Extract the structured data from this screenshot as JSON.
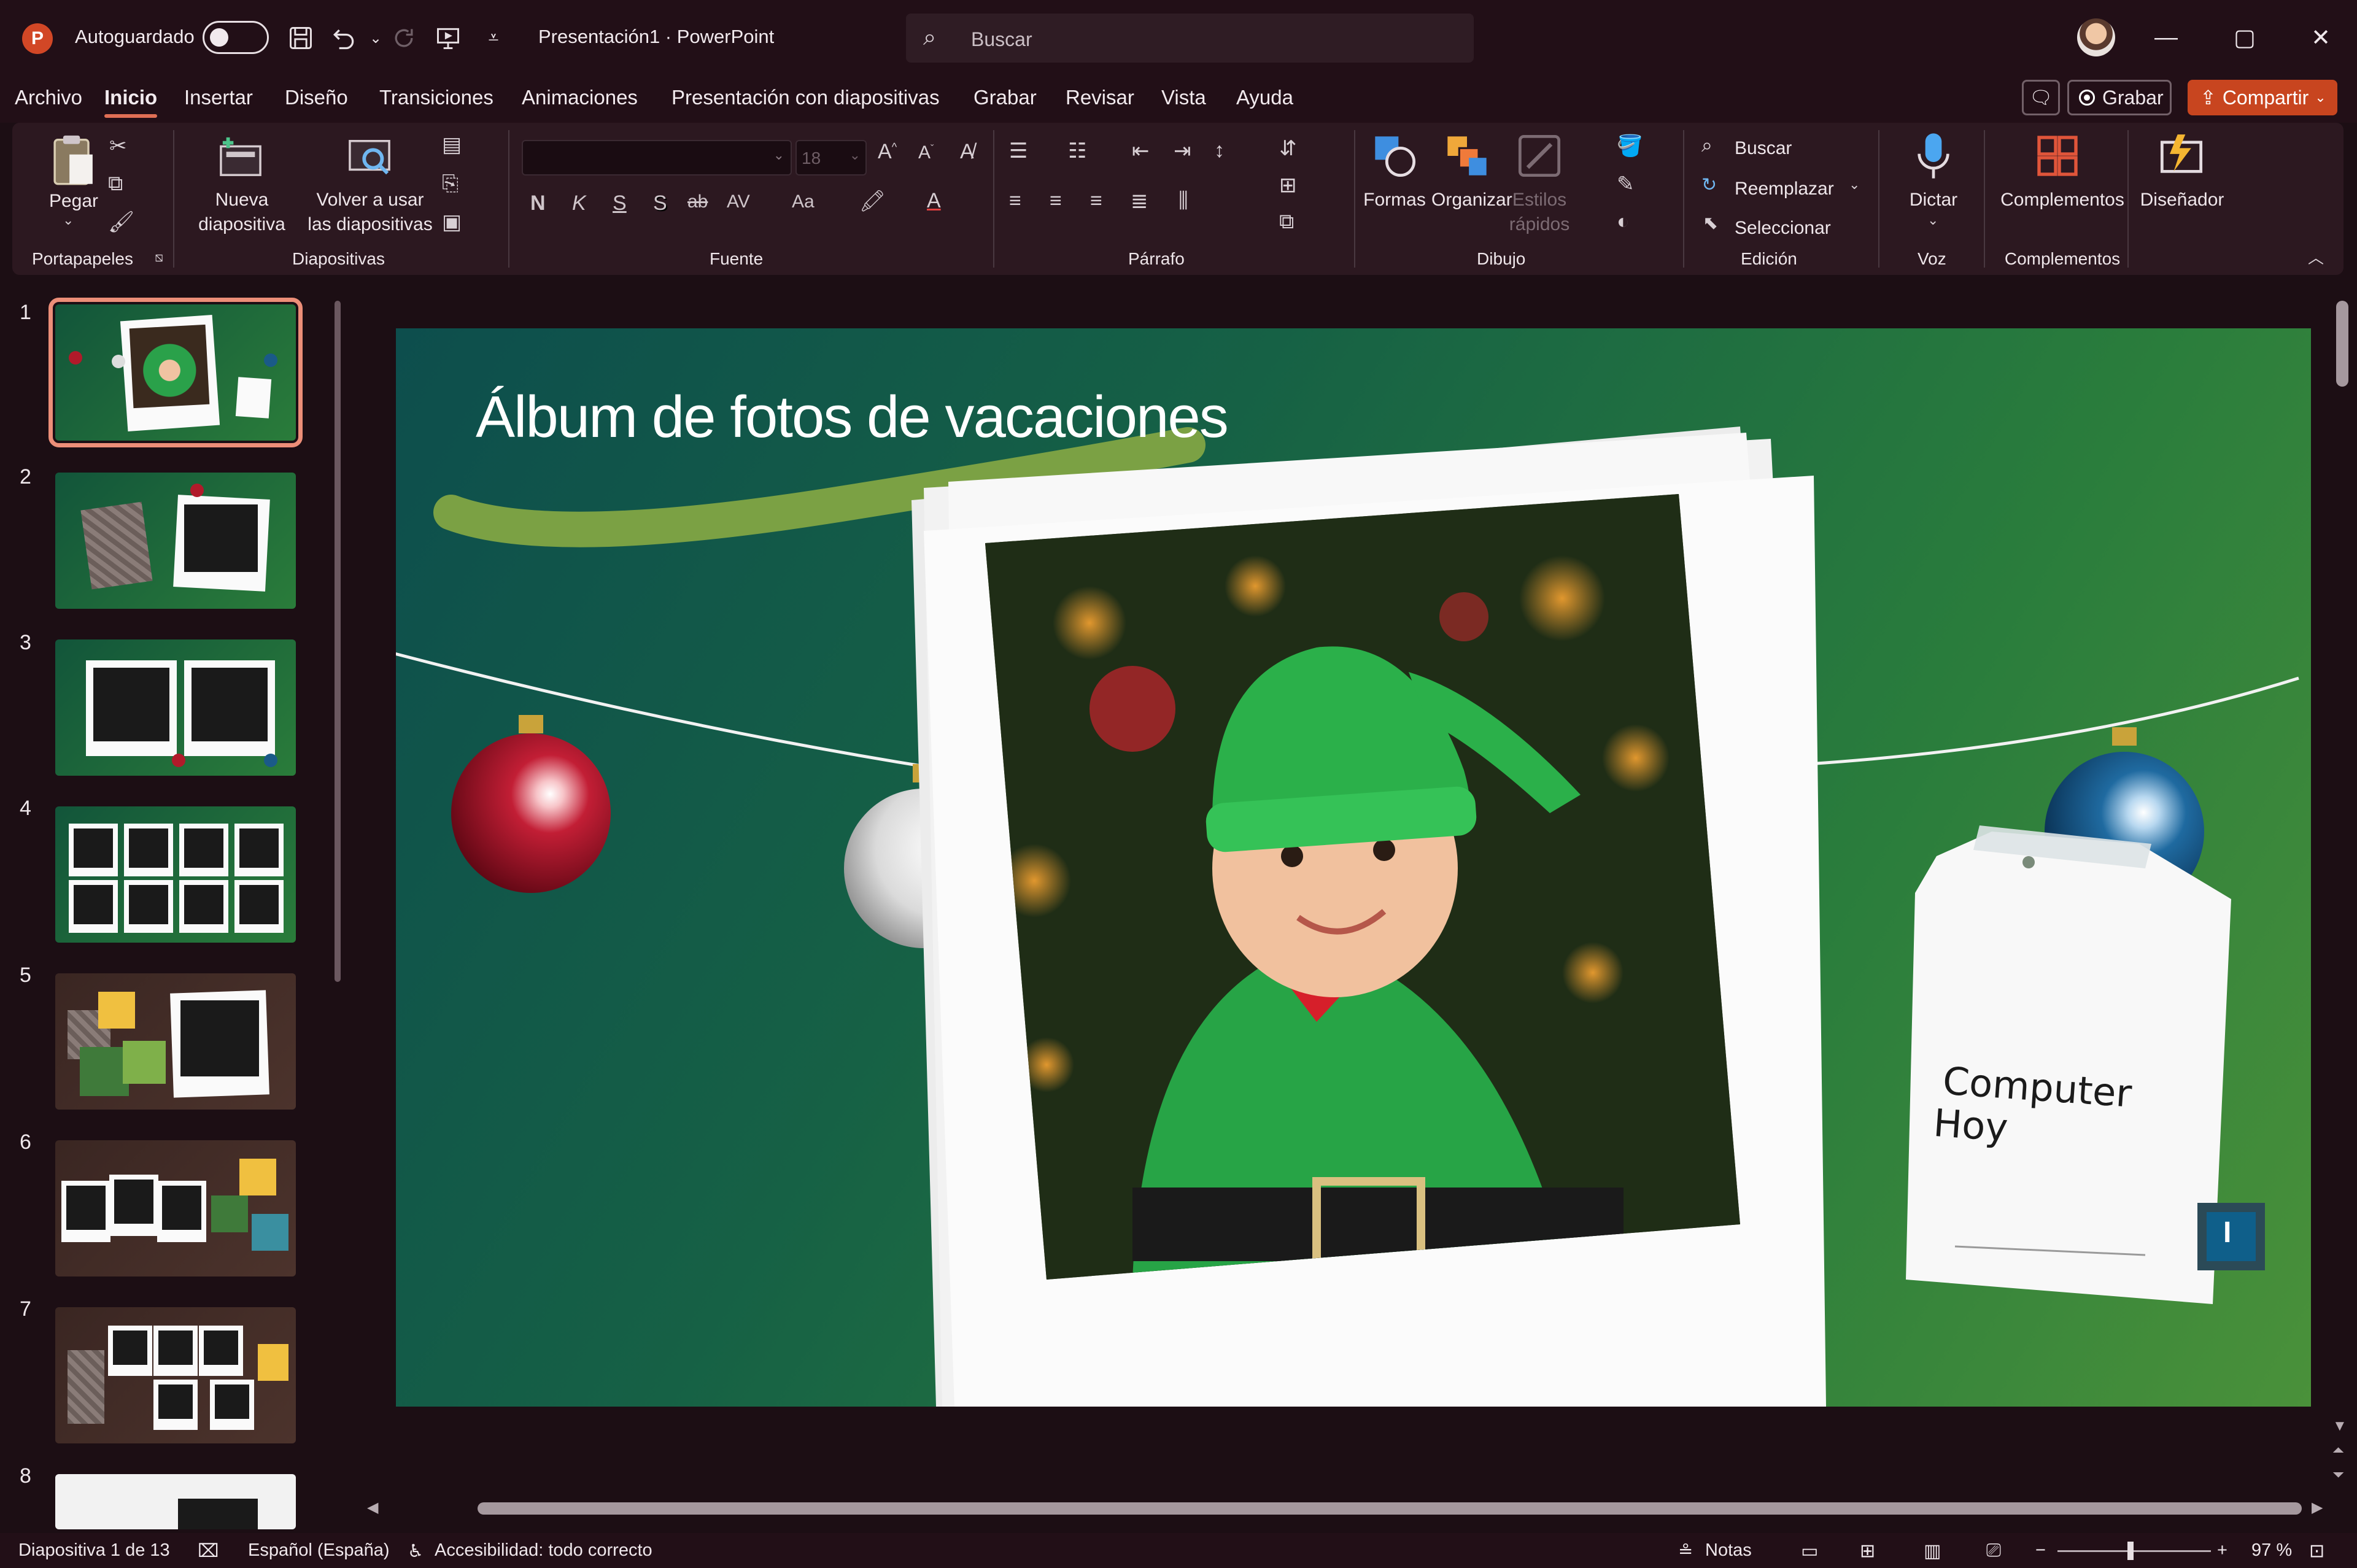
{
  "titlebar": {
    "autosave_label": "Autoguardado",
    "document_title": "Presentación1  ·  PowerPoint",
    "search_placeholder": "Buscar"
  },
  "menu": {
    "tabs": [
      "Archivo",
      "Inicio",
      "Insertar",
      "Diseño",
      "Transiciones",
      "Animaciones",
      "Presentación con diapositivas",
      "Grabar",
      "Revisar",
      "Vista",
      "Ayuda"
    ],
    "active_tab": "Inicio",
    "record_label": "Grabar",
    "share_label": "Compartir"
  },
  "ribbon": {
    "groups": {
      "clipboard": "Portapapeles",
      "slides": "Diapositivas",
      "font": "Fuente",
      "paragraph": "Párrafo",
      "drawing": "Dibujo",
      "editing": "Edición",
      "voice": "Voz",
      "addins": "Complementos"
    },
    "buttons": {
      "paste": "Pegar",
      "new_slide_1": "Nueva",
      "new_slide_2": "diapositiva",
      "reuse_1": "Volver a usar",
      "reuse_2": "las diapositivas",
      "font_size": "18",
      "shapes": "Formas",
      "arrange": "Organizar",
      "quick_styles_1": "Estilos",
      "quick_styles_2": "rápidos",
      "find": "Buscar",
      "replace": "Reemplazar",
      "select": "Seleccionar",
      "dictate": "Dictar",
      "addins": "Complementos",
      "designer": "Diseñador"
    },
    "format_glyphs": [
      "N",
      "K",
      "S",
      "S",
      "ab",
      "AV",
      "Aa"
    ]
  },
  "thumbnails": {
    "numbers": [
      "1",
      "2",
      "3",
      "4",
      "5",
      "6",
      "7",
      "8"
    ],
    "active_index": 1
  },
  "slide": {
    "title": "Álbum de fotos de vacaciones",
    "tag_line1": "Computer",
    "tag_line2": "Hoy",
    "badge": "I"
  },
  "statusbar": {
    "slide_counter": "Diapositiva 1 de 13",
    "language": "Español (España)",
    "accessibility": "Accesibilidad: todo correcto",
    "notes": "Notas",
    "zoom": "97 %"
  },
  "colors": {
    "accent": "#e06f55",
    "share": "#c8451f",
    "slide_bg_start": "#0d4e4d",
    "slide_bg_end": "#4a913a"
  }
}
